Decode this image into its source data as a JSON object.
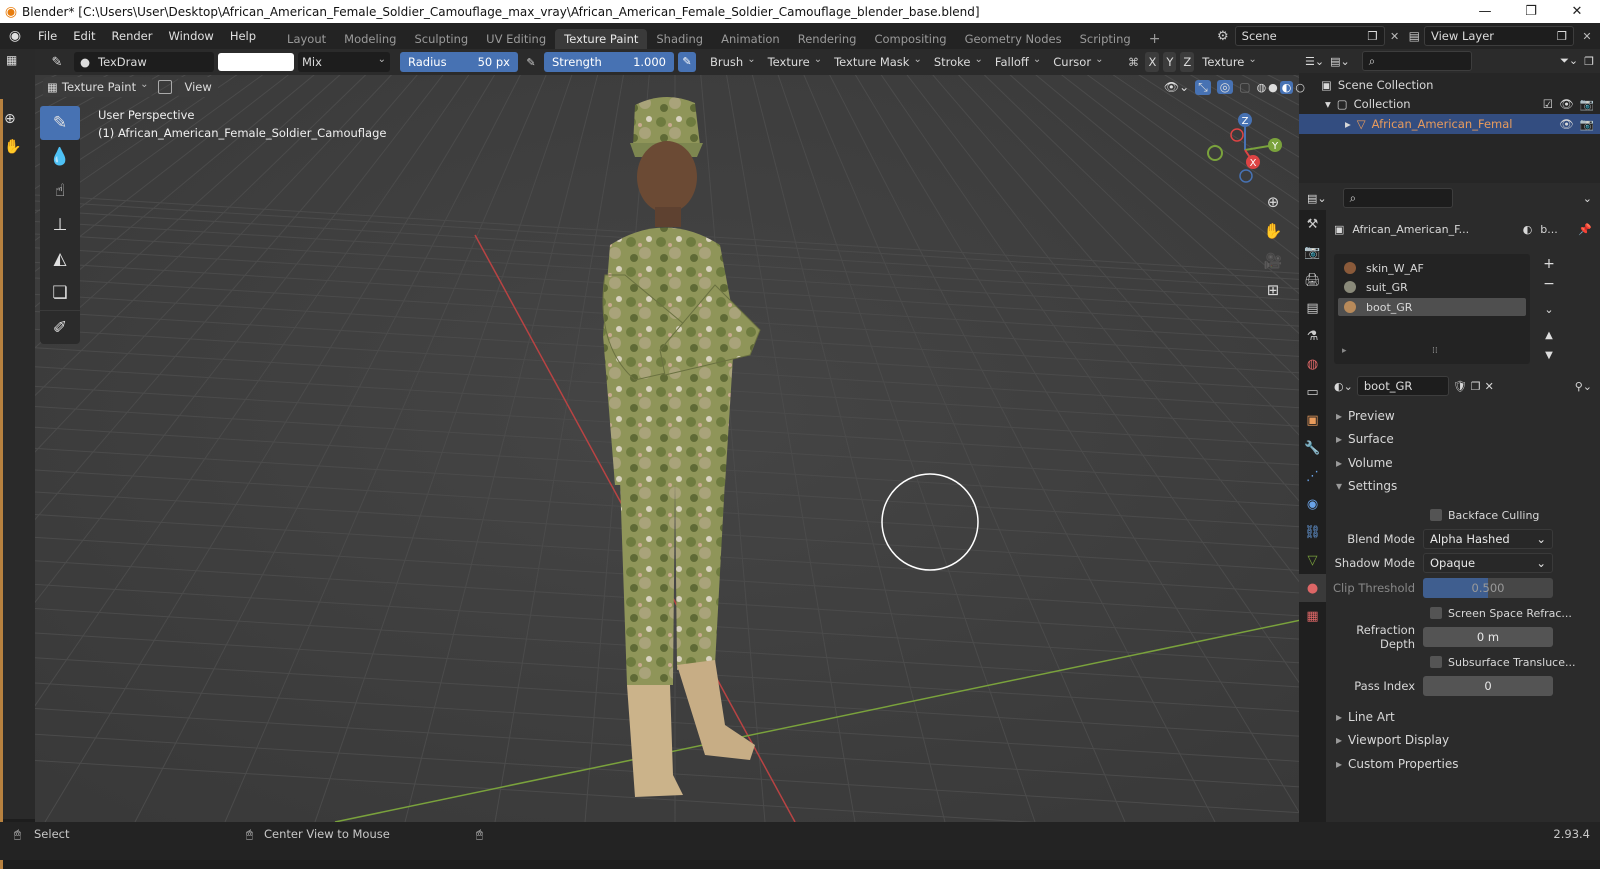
{
  "window": {
    "title": "Blender* [C:\\Users\\User\\Desktop\\African_American_Female_Soldier_Camouflage_max_vray\\African_American_Female_Soldier_Camouflage_blender_base.blend]"
  },
  "menu": [
    "File",
    "Edit",
    "Render",
    "Window",
    "Help"
  ],
  "workspaces": [
    {
      "label": "Layout"
    },
    {
      "label": "Modeling"
    },
    {
      "label": "Sculpting"
    },
    {
      "label": "UV Editing"
    },
    {
      "label": "Texture Paint",
      "active": true
    },
    {
      "label": "Shading"
    },
    {
      "label": "Animation"
    },
    {
      "label": "Rendering"
    },
    {
      "label": "Compositing"
    },
    {
      "label": "Geometry Nodes"
    },
    {
      "label": "Scripting"
    }
  ],
  "scene": {
    "name": "Scene",
    "view_layer": "View Layer"
  },
  "tool_header": {
    "brush_name": "TexDraw",
    "blend": "Mix",
    "radius_label": "Radius",
    "radius_value": "50 px",
    "strength_label": "Strength",
    "strength_value": "1.000",
    "brush": "Brush",
    "texture": "Texture",
    "texture_mask": "Texture Mask",
    "stroke": "Stroke",
    "falloff": "Falloff",
    "cursor": "Cursor",
    "x": "X",
    "y": "Y",
    "z": "Z",
    "texture_slots": "Texture"
  },
  "viewport": {
    "mode": "Texture Paint",
    "view_menu": "View",
    "perspective": "User Perspective",
    "object_label": "(1) African_American_Female_Soldier_Camouflage",
    "axis_x": "X",
    "axis_y": "Y",
    "axis_z": "Z"
  },
  "outliner": {
    "scene_collection": "Scene Collection",
    "collection": "Collection",
    "object": "African_American_Femal"
  },
  "properties": {
    "object_name": "African_American_F...",
    "material_short": "b...",
    "material_slots": [
      "skin_W_AF",
      "suit_GR",
      "boot_GR"
    ],
    "selected_slot": 2,
    "material_name": "boot_GR",
    "sections": {
      "preview": "Preview",
      "surface": "Surface",
      "volume": "Volume",
      "settings": "Settings",
      "line_art": "Line Art",
      "viewport_display": "Viewport Display",
      "custom_properties": "Custom Properties"
    },
    "backface_culling": "Backface Culling",
    "blend_mode_label": "Blend Mode",
    "blend_mode": "Alpha Hashed",
    "shadow_mode_label": "Shadow Mode",
    "shadow_mode": "Opaque",
    "clip_threshold_label": "Clip Threshold",
    "clip_threshold": "0.500",
    "screen_space_refraction": "Screen Space Refrac...",
    "refraction_depth_label": "Refraction Depth",
    "refraction_depth": "0 m",
    "subsurface_translucency": "Subsurface Transluce...",
    "pass_index_label": "Pass Index",
    "pass_index": "0"
  },
  "status": {
    "select": "Select",
    "center_view": "Center View to Mouse",
    "version": "2.93.4"
  },
  "colors": {
    "accent": "#4772b3",
    "active_object": "#e89b5c",
    "grid_x": "#b84343",
    "grid_y": "#7aa23c"
  }
}
